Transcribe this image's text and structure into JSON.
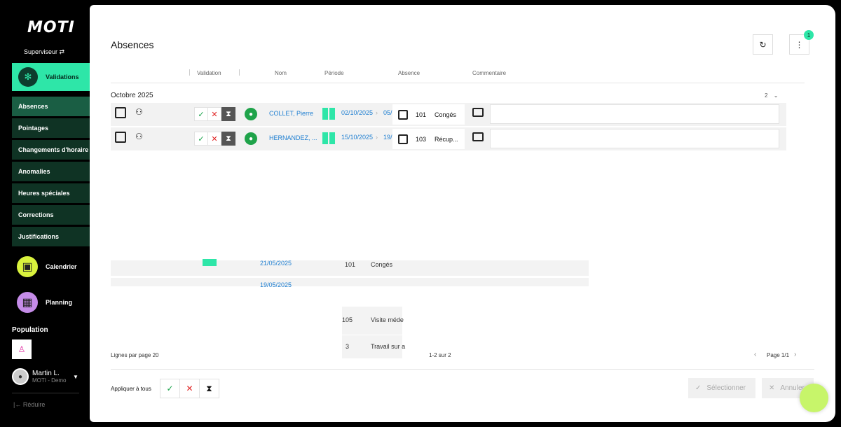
{
  "sidebar": {
    "logo": "MOTI",
    "role": "Superviseur",
    "main_item": "Validations",
    "sub_items": [
      "Absences",
      "Pointages",
      "Changements d'horaire",
      "Anomalies",
      "Heures spéciales",
      "Corrections",
      "Justifications"
    ],
    "calendar": "Calendrier",
    "planning": "Planning",
    "population_title": "Population",
    "user_name": "Martin L.",
    "user_org": "MOTI - Demo",
    "reduce": "Réduire"
  },
  "page": {
    "title": "Absences",
    "badge": "1",
    "columns": [
      "Validation",
      "Nom",
      "Période",
      "Absence",
      "Commentaire"
    ],
    "group": "Octobre 2025",
    "group_count": "2",
    "rows": [
      {
        "name": "COLLET, Pierre",
        "start": "02/10/2025",
        "end": "05/",
        "code": "101",
        "absence": "Congés"
      },
      {
        "name": "HERNANDEZ, ...",
        "start": "15/10/2025",
        "end": "19/",
        "code": "103",
        "absence": "Récup..."
      }
    ],
    "ghost": {
      "date_a": "21/05/2025",
      "code_a": "101",
      "abs_a": "Congés",
      "date_b": "19/05/2025",
      "code_c": "105",
      "abs_c": "Visite méde",
      "code_d": "3",
      "abs_d": "Travail sur a"
    },
    "lines_per_page": "Lignes par page 20",
    "range": "1-2 sur 2",
    "pager": "Page 1/1",
    "apply_all": "Appliquer à tous",
    "select_btn": "Sélectionner",
    "cancel_btn": "Annuler"
  },
  "colors": {
    "accent": "#2ee6a8",
    "link": "#1f7fd1",
    "ok": "#1aa34a",
    "no": "#e02424"
  }
}
